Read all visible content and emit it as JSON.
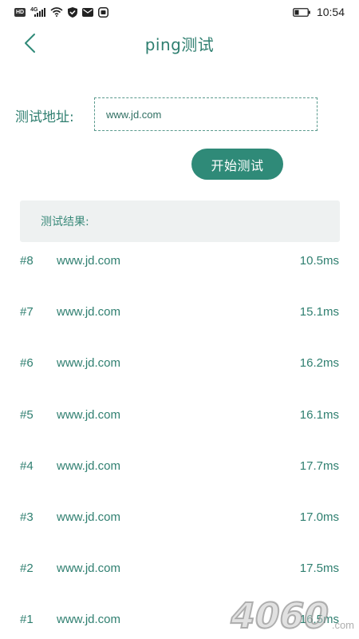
{
  "status_bar": {
    "hd_badge": "HD",
    "network_label": "4G",
    "time": "10:54",
    "icons": [
      "hd-badge-icon",
      "signal-icon",
      "wifi-icon",
      "shield-icon",
      "mail-icon",
      "camera-app-icon",
      "battery-icon"
    ]
  },
  "header": {
    "title": "ping测试",
    "back_icon": "chevron-left-icon"
  },
  "form": {
    "address_label": "测试地址:",
    "address_value": "www.jd.com",
    "start_button_label": "开始测试"
  },
  "results": {
    "header_label": "测试结果:",
    "rows": [
      {
        "index": "#8",
        "host": "www.jd.com",
        "time": "10.5ms"
      },
      {
        "index": "#7",
        "host": "www.jd.com",
        "time": "15.1ms"
      },
      {
        "index": "#6",
        "host": "www.jd.com",
        "time": "16.2ms"
      },
      {
        "index": "#5",
        "host": "www.jd.com",
        "time": "16.1ms"
      },
      {
        "index": "#4",
        "host": "www.jd.com",
        "time": "17.7ms"
      },
      {
        "index": "#3",
        "host": "www.jd.com",
        "time": "17.0ms"
      },
      {
        "index": "#2",
        "host": "www.jd.com",
        "time": "17.5ms"
      },
      {
        "index": "#1",
        "host": "www.jd.com",
        "time": "16.5ms"
      }
    ]
  },
  "watermark": {
    "text": "4060",
    "suffix": ".com"
  },
  "colors": {
    "accent": "#2f8a78",
    "text_accent": "#2f7f70",
    "results_header_bg": "#eef1f1"
  }
}
